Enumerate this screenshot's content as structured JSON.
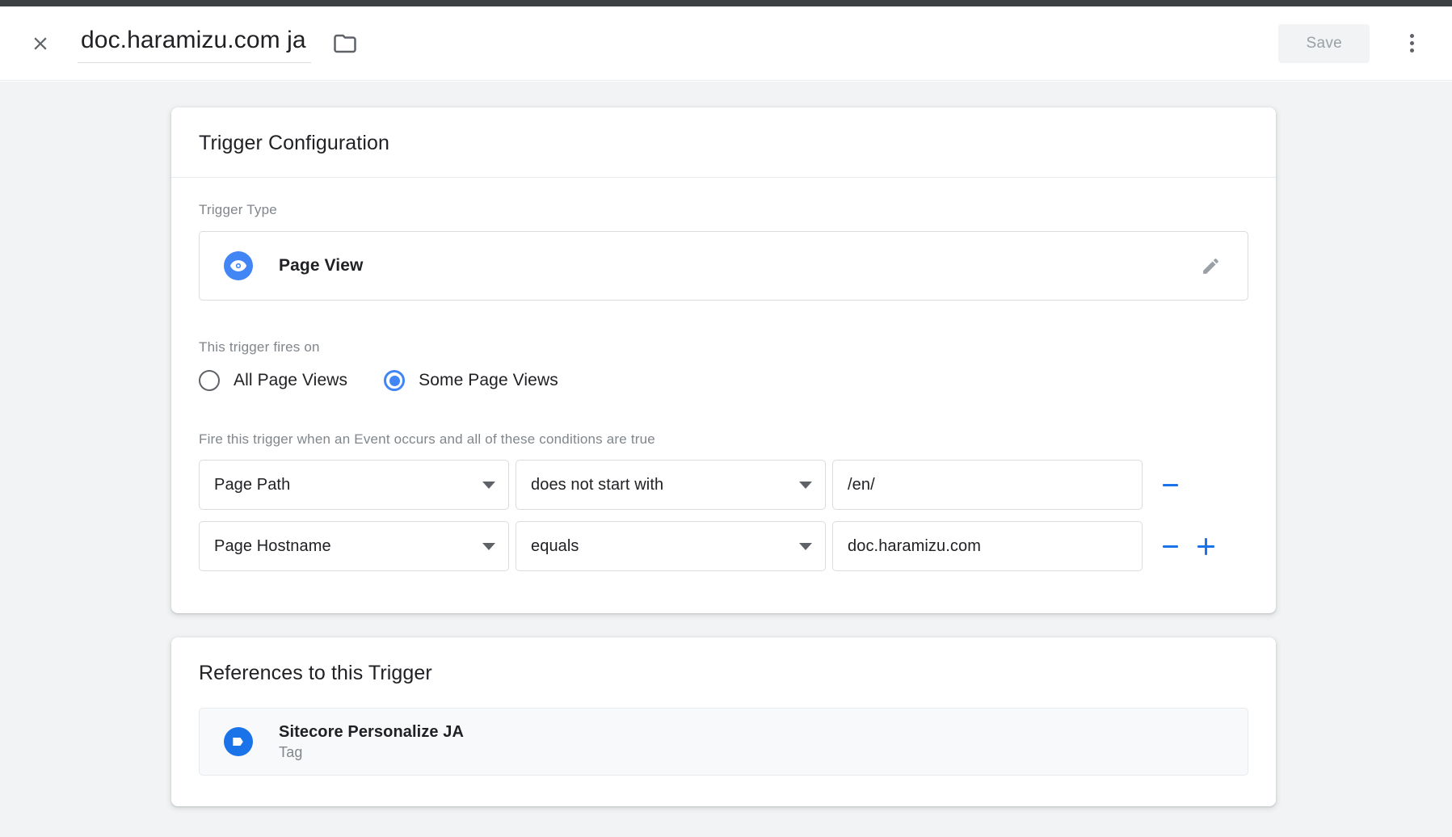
{
  "header": {
    "close_icon": "close-icon",
    "title": "doc.haramizu.com ja",
    "folder_icon": "folder-icon",
    "save_label": "Save",
    "more_icon": "more-vert-icon"
  },
  "trigger_card": {
    "heading": "Trigger Configuration",
    "trigger_type_label": "Trigger Type",
    "trigger_type": {
      "name": "Page View",
      "icon": "eye-icon",
      "edit_icon": "pencil-icon"
    },
    "fires_on_label": "This trigger fires on",
    "fires_on_options": [
      {
        "label": "All Page Views",
        "selected": false
      },
      {
        "label": "Some Page Views",
        "selected": true
      }
    ],
    "conditions_caption": "Fire this trigger when an Event occurs and all of these conditions are true",
    "conditions": [
      {
        "variable": "Page Path",
        "operator": "does not start with",
        "value": "/en/",
        "has_remove": true,
        "has_add": false
      },
      {
        "variable": "Page Hostname",
        "operator": "equals",
        "value": "doc.haramizu.com",
        "has_remove": true,
        "has_add": true
      }
    ]
  },
  "references_card": {
    "heading": "References to this Trigger",
    "items": [
      {
        "name": "Sitecore Personalize JA",
        "type": "Tag",
        "icon": "tag-icon"
      }
    ]
  },
  "colors": {
    "accent_blue": "#1a73e8",
    "icon_blue": "#4285f4",
    "page_bg": "#f1f3f4",
    "card_bg": "#ffffff",
    "muted_text": "#80868b"
  }
}
